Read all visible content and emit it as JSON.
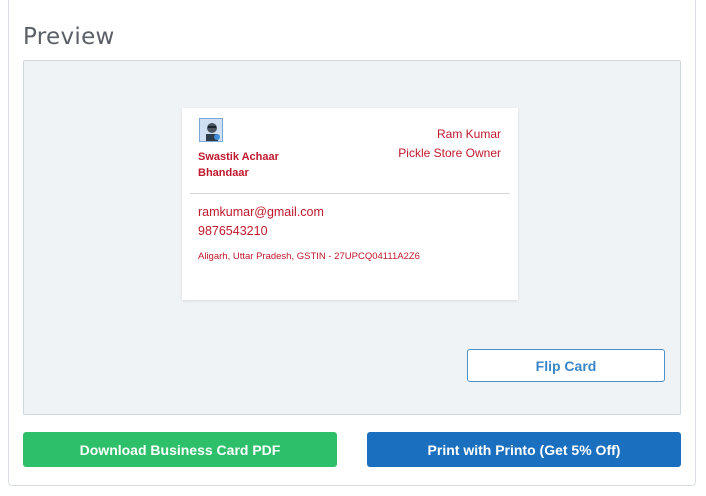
{
  "preview": {
    "title": "Preview"
  },
  "card": {
    "company": "Swastik Achaar Bhandaar",
    "owner_name": "Ram Kumar",
    "owner_title": "Pickle Store Owner",
    "email": "ramkumar@gmail.com",
    "phone": "9876543210",
    "address": "Aligarh, Uttar Pradesh, GSTIN - 27UPCQ04111A2Z6",
    "text_color": "#c0182c",
    "logo_icon": "user-avatar-icon"
  },
  "actions": {
    "flip_label": "Flip Card",
    "download_label": "Download Business Card PDF",
    "print_label": "Print with Printo (Get 5% Off)"
  },
  "colors": {
    "download": "#2dbf6a",
    "print": "#1a6fbe",
    "flip_border": "#4a90c9"
  }
}
